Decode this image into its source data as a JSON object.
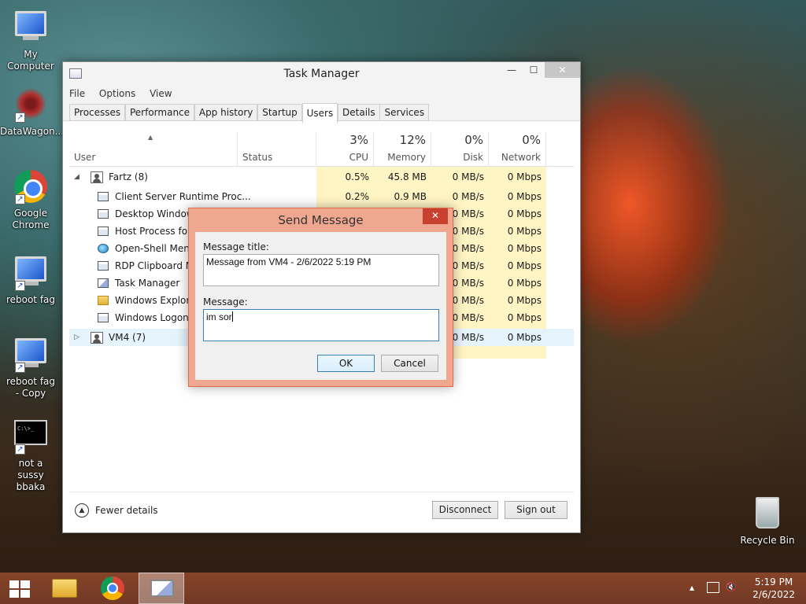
{
  "desktop": {
    "icons": [
      {
        "label": "My Computer"
      },
      {
        "label": "DataWagon..."
      },
      {
        "label": "Google Chrome"
      },
      {
        "label": "reboot fag"
      },
      {
        "label": "reboot fag - Copy"
      },
      {
        "label": "not a sussy bbaka"
      },
      {
        "label": "Recycle Bin"
      }
    ]
  },
  "task_manager": {
    "title": "Task Manager",
    "window_buttons": {
      "minimize": "—",
      "maximize": "☐",
      "close": "✕"
    },
    "menu": [
      "File",
      "Options",
      "View"
    ],
    "tabs": [
      "Processes",
      "Performance",
      "App history",
      "Startup",
      "Users",
      "Details",
      "Services"
    ],
    "active_tab": "Users",
    "columns": {
      "user": "User",
      "status": "Status",
      "cpu": {
        "pct": "3%",
        "label": "CPU"
      },
      "memory": {
        "pct": "12%",
        "label": "Memory"
      },
      "disk": {
        "pct": "0%",
        "label": "Disk"
      },
      "network": {
        "pct": "0%",
        "label": "Network"
      }
    },
    "users": [
      {
        "name": "Fartz (8)",
        "expanded": true,
        "cpu": "0.5%",
        "memory": "45.8 MB",
        "disk": "0 MB/s",
        "network": "0 Mbps",
        "processes": [
          {
            "name": "Client Server Runtime Proc...",
            "icon": "window-icon",
            "cpu": "0.2%",
            "memory": "0.9 MB",
            "disk": "0 MB/s",
            "network": "0 Mbps"
          },
          {
            "name": "Desktop Window",
            "icon": "window-icon",
            "cpu": "",
            "memory": "",
            "disk": "0 MB/s",
            "network": "0 Mbps"
          },
          {
            "name": "Host Process for W",
            "icon": "window-icon",
            "cpu": "",
            "memory": "",
            "disk": "0 MB/s",
            "network": "0 Mbps"
          },
          {
            "name": "Open-Shell Menu",
            "icon": "globe-icon",
            "cpu": "",
            "memory": "",
            "disk": "0 MB/s",
            "network": "0 Mbps"
          },
          {
            "name": "RDP Clipboard Mo",
            "icon": "window-icon",
            "cpu": "",
            "memory": "",
            "disk": "0 MB/s",
            "network": "0 Mbps"
          },
          {
            "name": "Task Manager",
            "icon": "chart-icon",
            "cpu": "",
            "memory": "",
            "disk": "0 MB/s",
            "network": "0 Mbps"
          },
          {
            "name": "Windows Explorer",
            "icon": "folder-icon",
            "cpu": "",
            "memory": "",
            "disk": "0 MB/s",
            "network": "0 Mbps"
          },
          {
            "name": "Windows Logon A",
            "icon": "window-icon",
            "cpu": "",
            "memory": "",
            "disk": "0 MB/s",
            "network": "0 Mbps"
          }
        ]
      },
      {
        "name": "VM4 (7)",
        "expanded": false,
        "cpu": "",
        "memory": "",
        "disk": "0 MB/s",
        "network": "0 Mbps"
      }
    ],
    "footer": {
      "fewer_details": "Fewer details",
      "disconnect": "Disconnect",
      "sign_out": "Sign out"
    }
  },
  "send_message": {
    "title": "Send Message",
    "close": "✕",
    "message_title_label": "Message title:",
    "message_title_value": "Message from VM4 - 2/6/2022 5:19 PM",
    "message_label": "Message:",
    "message_value": "im sor",
    "ok": "OK",
    "cancel": "Cancel"
  },
  "taskbar": {
    "tray_arrow": "▲",
    "time": "5:19 PM",
    "date": "2/6/2022"
  },
  "colors": {
    "heat": "#fff4c4",
    "dialog_frame": "#f0a78f",
    "dialog_close": "#c74030",
    "taskbar": "#8a4a30"
  }
}
